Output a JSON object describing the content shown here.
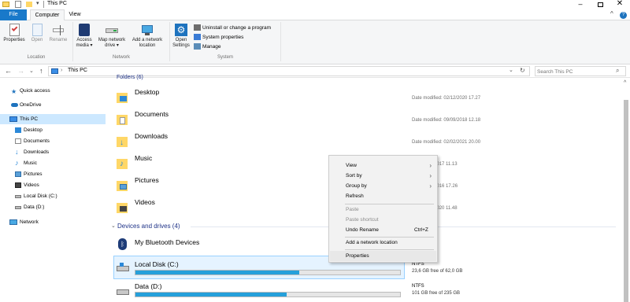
{
  "window": {
    "title": "This PC"
  },
  "tabs": {
    "file": "File",
    "computer": "Computer",
    "view": "View"
  },
  "ribbon": {
    "location": {
      "label": "Location",
      "properties": "Properties",
      "open": "Open",
      "rename": "Rename"
    },
    "network": {
      "label": "Network",
      "access_media": [
        "Access",
        "media ▾"
      ],
      "map_drive": [
        "Map network",
        "drive ▾"
      ],
      "add_location": [
        "Add a network",
        "location"
      ]
    },
    "system": {
      "label": "System",
      "open_settings": [
        "Open",
        "Settings"
      ],
      "uninstall": "Uninstall or change a program",
      "system_properties": "System properties",
      "manage": "Manage"
    }
  },
  "address": {
    "path": "This PC",
    "search_placeholder": "Search This PC"
  },
  "nav": {
    "items": [
      {
        "label": "Quick access",
        "icon": "star-icon"
      },
      {
        "label": "OneDrive",
        "icon": "cloud-icon"
      },
      {
        "label": "This PC",
        "icon": "computer-icon",
        "selected": true
      },
      {
        "label": "Desktop",
        "icon": "desktop-folder-icon"
      },
      {
        "label": "Documents",
        "icon": "documents-folder-icon"
      },
      {
        "label": "Downloads",
        "icon": "downloads-folder-icon"
      },
      {
        "label": "Music",
        "icon": "music-folder-icon"
      },
      {
        "label": "Pictures",
        "icon": "pictures-folder-icon"
      },
      {
        "label": "Videos",
        "icon": "videos-folder-icon"
      },
      {
        "label": "Local Disk (C:)",
        "icon": "drive-icon"
      },
      {
        "label": "Data (D:)",
        "icon": "drive-icon"
      },
      {
        "label": "Network",
        "icon": "network-icon"
      }
    ]
  },
  "content": {
    "folders_header": "Folders (6)",
    "folders": [
      {
        "name": "Desktop",
        "modified": "Date modified: 02/12/2020 17.27"
      },
      {
        "name": "Documents",
        "modified": "Date modified: 09/09/2018 12.18"
      },
      {
        "name": "Downloads",
        "modified": "Date modified: 02/02/2021 20.00"
      },
      {
        "name": "Music",
        "modified": "ied: 14/05/2017 11.13"
      },
      {
        "name": "Pictures",
        "modified": "ied: 06/05/2016 17.26"
      },
      {
        "name": "Videos",
        "modified": "ied: 08/12/2020 11.48"
      }
    ],
    "devices_header": "Devices and drives (4)",
    "devices": [
      {
        "name": "My Bluetooth Devices"
      },
      {
        "name": "Local Disk (C:)",
        "fs": "NTFS",
        "free": "23,6 GB free of 62,0 GB",
        "used_fraction": 0.62
      },
      {
        "name": "Data (D:)",
        "fs": "NTFS",
        "free": "101 GB free of 235 GB",
        "used_fraction": 0.57
      }
    ]
  },
  "context_menu": {
    "view": "View",
    "sort_by": "Sort by",
    "group_by": "Group by",
    "refresh": "Refresh",
    "paste": "Paste",
    "paste_shortcut": "Paste shortcut",
    "undo_rename": "Undo Rename",
    "undo_shortcut": "Ctrl+Z",
    "add_network_location": "Add a network location",
    "properties": "Properties"
  },
  "colors": {
    "accent": "#0078d7",
    "selected": "#cce8ff",
    "folder": "#ffd767",
    "drive_bar": "#26a0da"
  }
}
